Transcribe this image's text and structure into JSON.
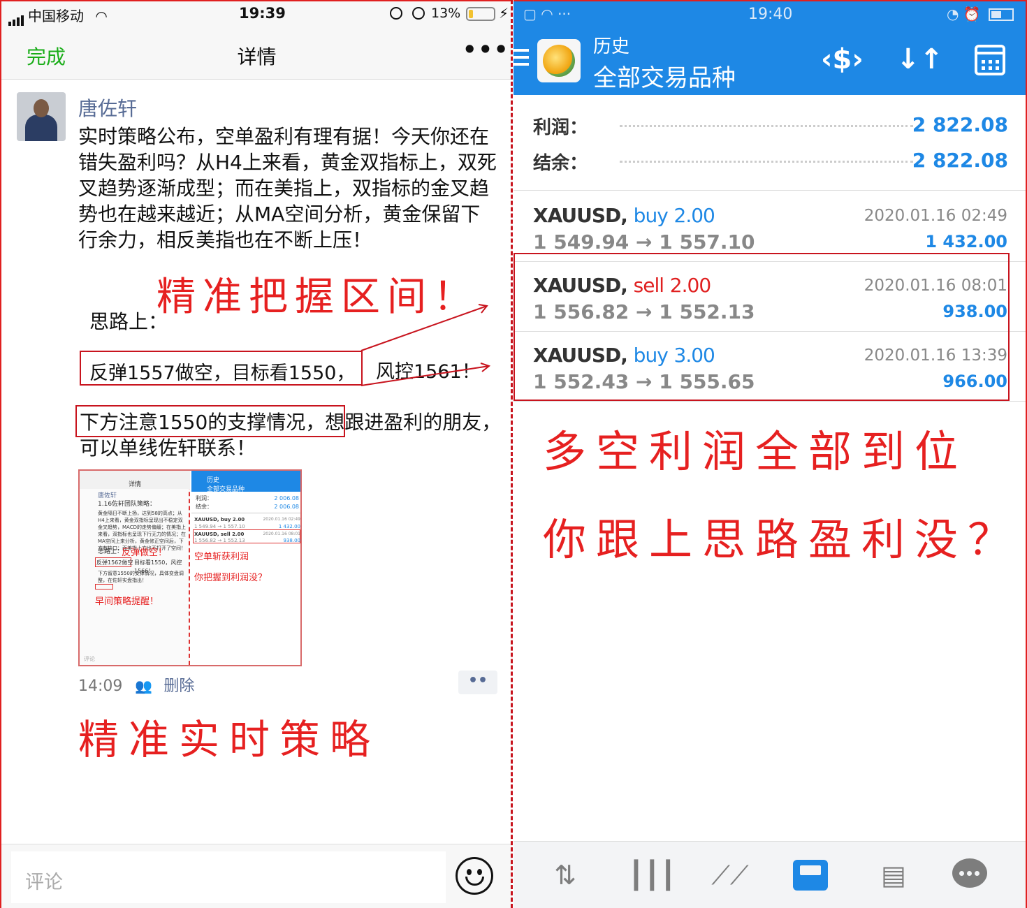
{
  "left": {
    "status": {
      "carrier": "中国移动",
      "time": "19:39",
      "battery": "13%"
    },
    "nav": {
      "done": "完成",
      "title": "详情",
      "more": "•••"
    },
    "post": {
      "author": "唐佐轩",
      "body": "实时策略公布，空单盈利有理有据！今天你还在错失盈利吗？从H4上来看，黄金双指标上，双死叉趋势逐渐成型；而在美指上，双指标的金叉趋势也在越来越近；从MA空间分析，黄金保留下行余力，相反美指也在不断上压！",
      "thinking": "思路上：",
      "line1": "反弹1557做空，目标看1550，",
      "line1_rest": "风控1561！",
      "line2": "下方注意1550的支撑情况，想跟进盈利的朋友，可以单线佐轩联系！",
      "annotation_top": "精准把握区间！",
      "annotation_bottom": "精准实时策略",
      "time": "14:09",
      "delete": "删除",
      "more_btn": "••"
    },
    "thumbnail": {
      "left_title": "详情",
      "author": "唐佐轩",
      "subtitle": "1.16佐轩团队策略：",
      "text": "黄金隔日不断上扬，达到58的高点；从H4上来看，黄金双指标呈现出不稳定双金叉趋势，MACD的走势偏缓；在美指上来看，双指标也呈现下行无力的情况；在MA空间上来分析，黄金修正空间后，下方有缺口；而美指上方也不打开了空间！",
      "thinking": "思路上：",
      "red1": "反弹做空！",
      "box1": "反弹1562做空",
      "rest1": "目标看1550，风控1566！",
      "text2": "下方留意1550的支撑情况，具体变盘调整，在佐轩实盘指出！",
      "red2": "早间策略提醒！",
      "comment": "评论",
      "right_title": "历史",
      "right_sub": "全部交易品种",
      "profit_label": "利润：",
      "profit_val": "2 006.08",
      "balance_label": "结余：",
      "balance_val": "2 006.08",
      "t1": "XAUUSD, buy 2.00",
      "t1p": "1 549.94 → 1 557.10",
      "t1v": "1 432.00",
      "t1d": "2020.01.16 02:49",
      "t2": "XAUUSD, sell 2.00",
      "t2p": "1 556.82 → 1 552.13",
      "t2v": "938.00",
      "t2d": "2020.01.16 08:01",
      "red3": "空单斩获利润",
      "red4": "你把握到利润没？"
    },
    "comment": {
      "placeholder": "评论"
    }
  },
  "right": {
    "status": {
      "time": "19:40"
    },
    "header": {
      "title": "历史",
      "subtitle": "全部交易品种"
    },
    "summary": [
      {
        "label": "利润：",
        "value": "2 822.08"
      },
      {
        "label": "结余：",
        "value": "2 822.08"
      }
    ],
    "trades": [
      {
        "symbol": "XAUUSD,",
        "side": "buy",
        "volume": "2.00",
        "prices": "1 549.94 → 1 557.10",
        "date": "2020.01.16 02:49",
        "pnl": "1 432.00"
      },
      {
        "symbol": "XAUUSD,",
        "side": "sell",
        "volume": "2.00",
        "prices": "1 556.82 → 1 552.13",
        "date": "2020.01.16 08:01",
        "pnl": "938.00"
      },
      {
        "symbol": "XAUUSD,",
        "side": "buy",
        "volume": "3.00",
        "prices": "1 552.43 → 1 555.65",
        "date": "2020.01.16 13:39",
        "pnl": "966.00"
      }
    ],
    "annotation1": "多空利润全部到位",
    "annotation2": "你跟上思路盈利没？",
    "colors": {
      "accent": "#1e88e5",
      "annotation": "#e62020",
      "sell": "#e02020",
      "wechat_green": "#1aad19",
      "link": "#576b95"
    }
  }
}
